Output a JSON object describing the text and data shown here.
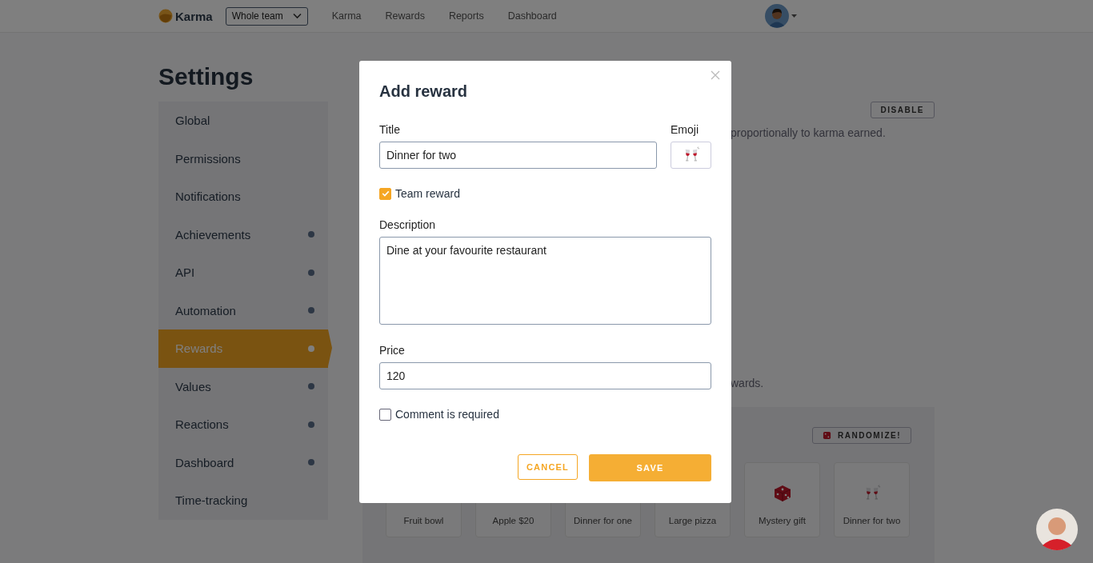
{
  "header": {
    "brand": "Karma",
    "team_select": "Whole team",
    "nav": [
      {
        "label": "Karma"
      },
      {
        "label": "Rewards"
      },
      {
        "label": "Reports"
      },
      {
        "label": "Dashboard"
      }
    ]
  },
  "page_title": "Settings",
  "sidebar": {
    "items": [
      {
        "label": "Global",
        "selected": false,
        "dot": false
      },
      {
        "label": "Permissions",
        "selected": false,
        "dot": false
      },
      {
        "label": "Notifications",
        "selected": false,
        "dot": false
      },
      {
        "label": "Achievements",
        "selected": false,
        "dot": true
      },
      {
        "label": "API",
        "selected": false,
        "dot": true
      },
      {
        "label": "Automation",
        "selected": false,
        "dot": true
      },
      {
        "label": "Rewards",
        "selected": true,
        "dot": true
      },
      {
        "label": "Values",
        "selected": false,
        "dot": true
      },
      {
        "label": "Reactions",
        "selected": false,
        "dot": true
      },
      {
        "label": "Dashboard",
        "selected": false,
        "dot": true
      },
      {
        "label": "Time-tracking",
        "selected": false,
        "dot": false
      }
    ]
  },
  "content": {
    "disable_button": "DISABLE",
    "text_1": "proportionally to karma earned.",
    "text_2": "wards.",
    "randomize_button": "RANDOMIZE!",
    "rewards": [
      {
        "label": "Fruit bowl",
        "kind": "plain"
      },
      {
        "label": "Apple $20",
        "kind": "plain"
      },
      {
        "label": "Dinner for one",
        "kind": "plain"
      },
      {
        "label": "Large pizza",
        "kind": "plain"
      },
      {
        "label": "Mystery gift",
        "kind": "dice"
      },
      {
        "label": "Dinner for two",
        "kind": "glasses"
      }
    ]
  },
  "modal": {
    "title": "Add reward",
    "title_label": "Title",
    "title_value": "Dinner for two",
    "emoji_label": "Emoji",
    "team_reward": {
      "label": "Team reward",
      "checked": true
    },
    "description_label": "Description",
    "description_value": "Dine at your favourite restaurant",
    "price_label": "Price",
    "price_value": "120",
    "comment_required": {
      "label": "Comment is required",
      "checked": false
    },
    "cancel": "CANCEL",
    "save": "SAVE"
  }
}
